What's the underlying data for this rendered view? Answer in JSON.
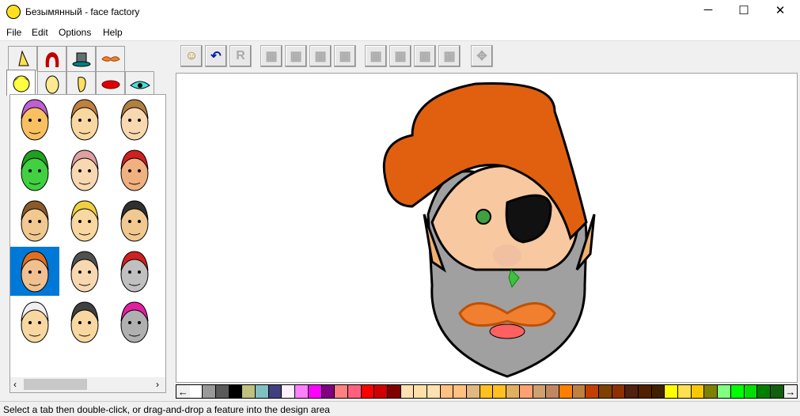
{
  "window": {
    "title": "Безымянный - face factory",
    "minimize": "─",
    "maximize": "☐",
    "close": "✕"
  },
  "menu": [
    "File",
    "Edit",
    "Options",
    "Help"
  ],
  "tabs_top": [
    "nose",
    "hair",
    "hat",
    "moustache"
  ],
  "tabs_bottom": [
    "head",
    "face-shape",
    "ear",
    "lips",
    "eye"
  ],
  "toolbar": [
    "new-face",
    "undo",
    "redo",
    "flip-h",
    "flip-v",
    "rotate-left",
    "rotate-right",
    "move-left",
    "move-right",
    "move-up",
    "move-down",
    "move-all"
  ],
  "thumbnails": [
    {
      "hair": "#c060d0",
      "skin": "#f8c060",
      "sel": false
    },
    {
      "hair": "#c08040",
      "skin": "#f8d8a0",
      "sel": false
    },
    {
      "hair": "#b08040",
      "skin": "#f8d8b0",
      "sel": false
    },
    {
      "hair": "#20a020",
      "skin": "#40d040",
      "sel": false
    },
    {
      "hair": "#e0a0a0",
      "skin": "#f8d8b0",
      "sel": false
    },
    {
      "hair": "#d02020",
      "skin": "#f0b080",
      "sel": false
    },
    {
      "hair": "#8b5a2b",
      "skin": "#f0c890",
      "sel": false
    },
    {
      "hair": "#f0d040",
      "skin": "#f8d8a0",
      "sel": false
    },
    {
      "hair": "#303030",
      "skin": "#f0c890",
      "sel": false
    },
    {
      "hair": "#e07020",
      "skin": "#f0c090",
      "sel": true
    },
    {
      "hair": "#505050",
      "skin": "#f8d8b0",
      "sel": false
    },
    {
      "hair": "#d02020",
      "skin": "#c0c0c0",
      "sel": false
    },
    {
      "hair": "#f0f0f0",
      "skin": "#f8d8a0",
      "sel": false
    },
    {
      "hair": "#404040",
      "skin": "#f8d8a0",
      "sel": false
    },
    {
      "hair": "#e020a0",
      "skin": "#b0b0b0",
      "sel": false
    }
  ],
  "palette": [
    "#ffffff",
    "#999999",
    "#5a5a5a",
    "#000000",
    "#c0c080",
    "#80c0c0",
    "#404080",
    "#fff0ff",
    "#ff80ff",
    "#ff00ff",
    "#800080",
    "#ff8080",
    "#ff6080",
    "#ff0000",
    "#d00000",
    "#800000",
    "#ffe0b0",
    "#ffe0a8",
    "#ffe0b0",
    "#ffc080",
    "#ffc080",
    "#e0b880",
    "#ffc020",
    "#ffc020",
    "#e0b060",
    "#ffa070",
    "#d0a070",
    "#c08860",
    "#ff8000",
    "#c08040",
    "#c04000",
    "#804000",
    "#903000",
    "#502010",
    "#502000",
    "#402000",
    "#ffff00",
    "#ffe050",
    "#f8c800",
    "#808000",
    "#80ff80",
    "#00ff00",
    "#00e000",
    "#008000",
    "#106010"
  ],
  "status": "Select a tab then double-click, or drag-and-drop a feature into the design area"
}
